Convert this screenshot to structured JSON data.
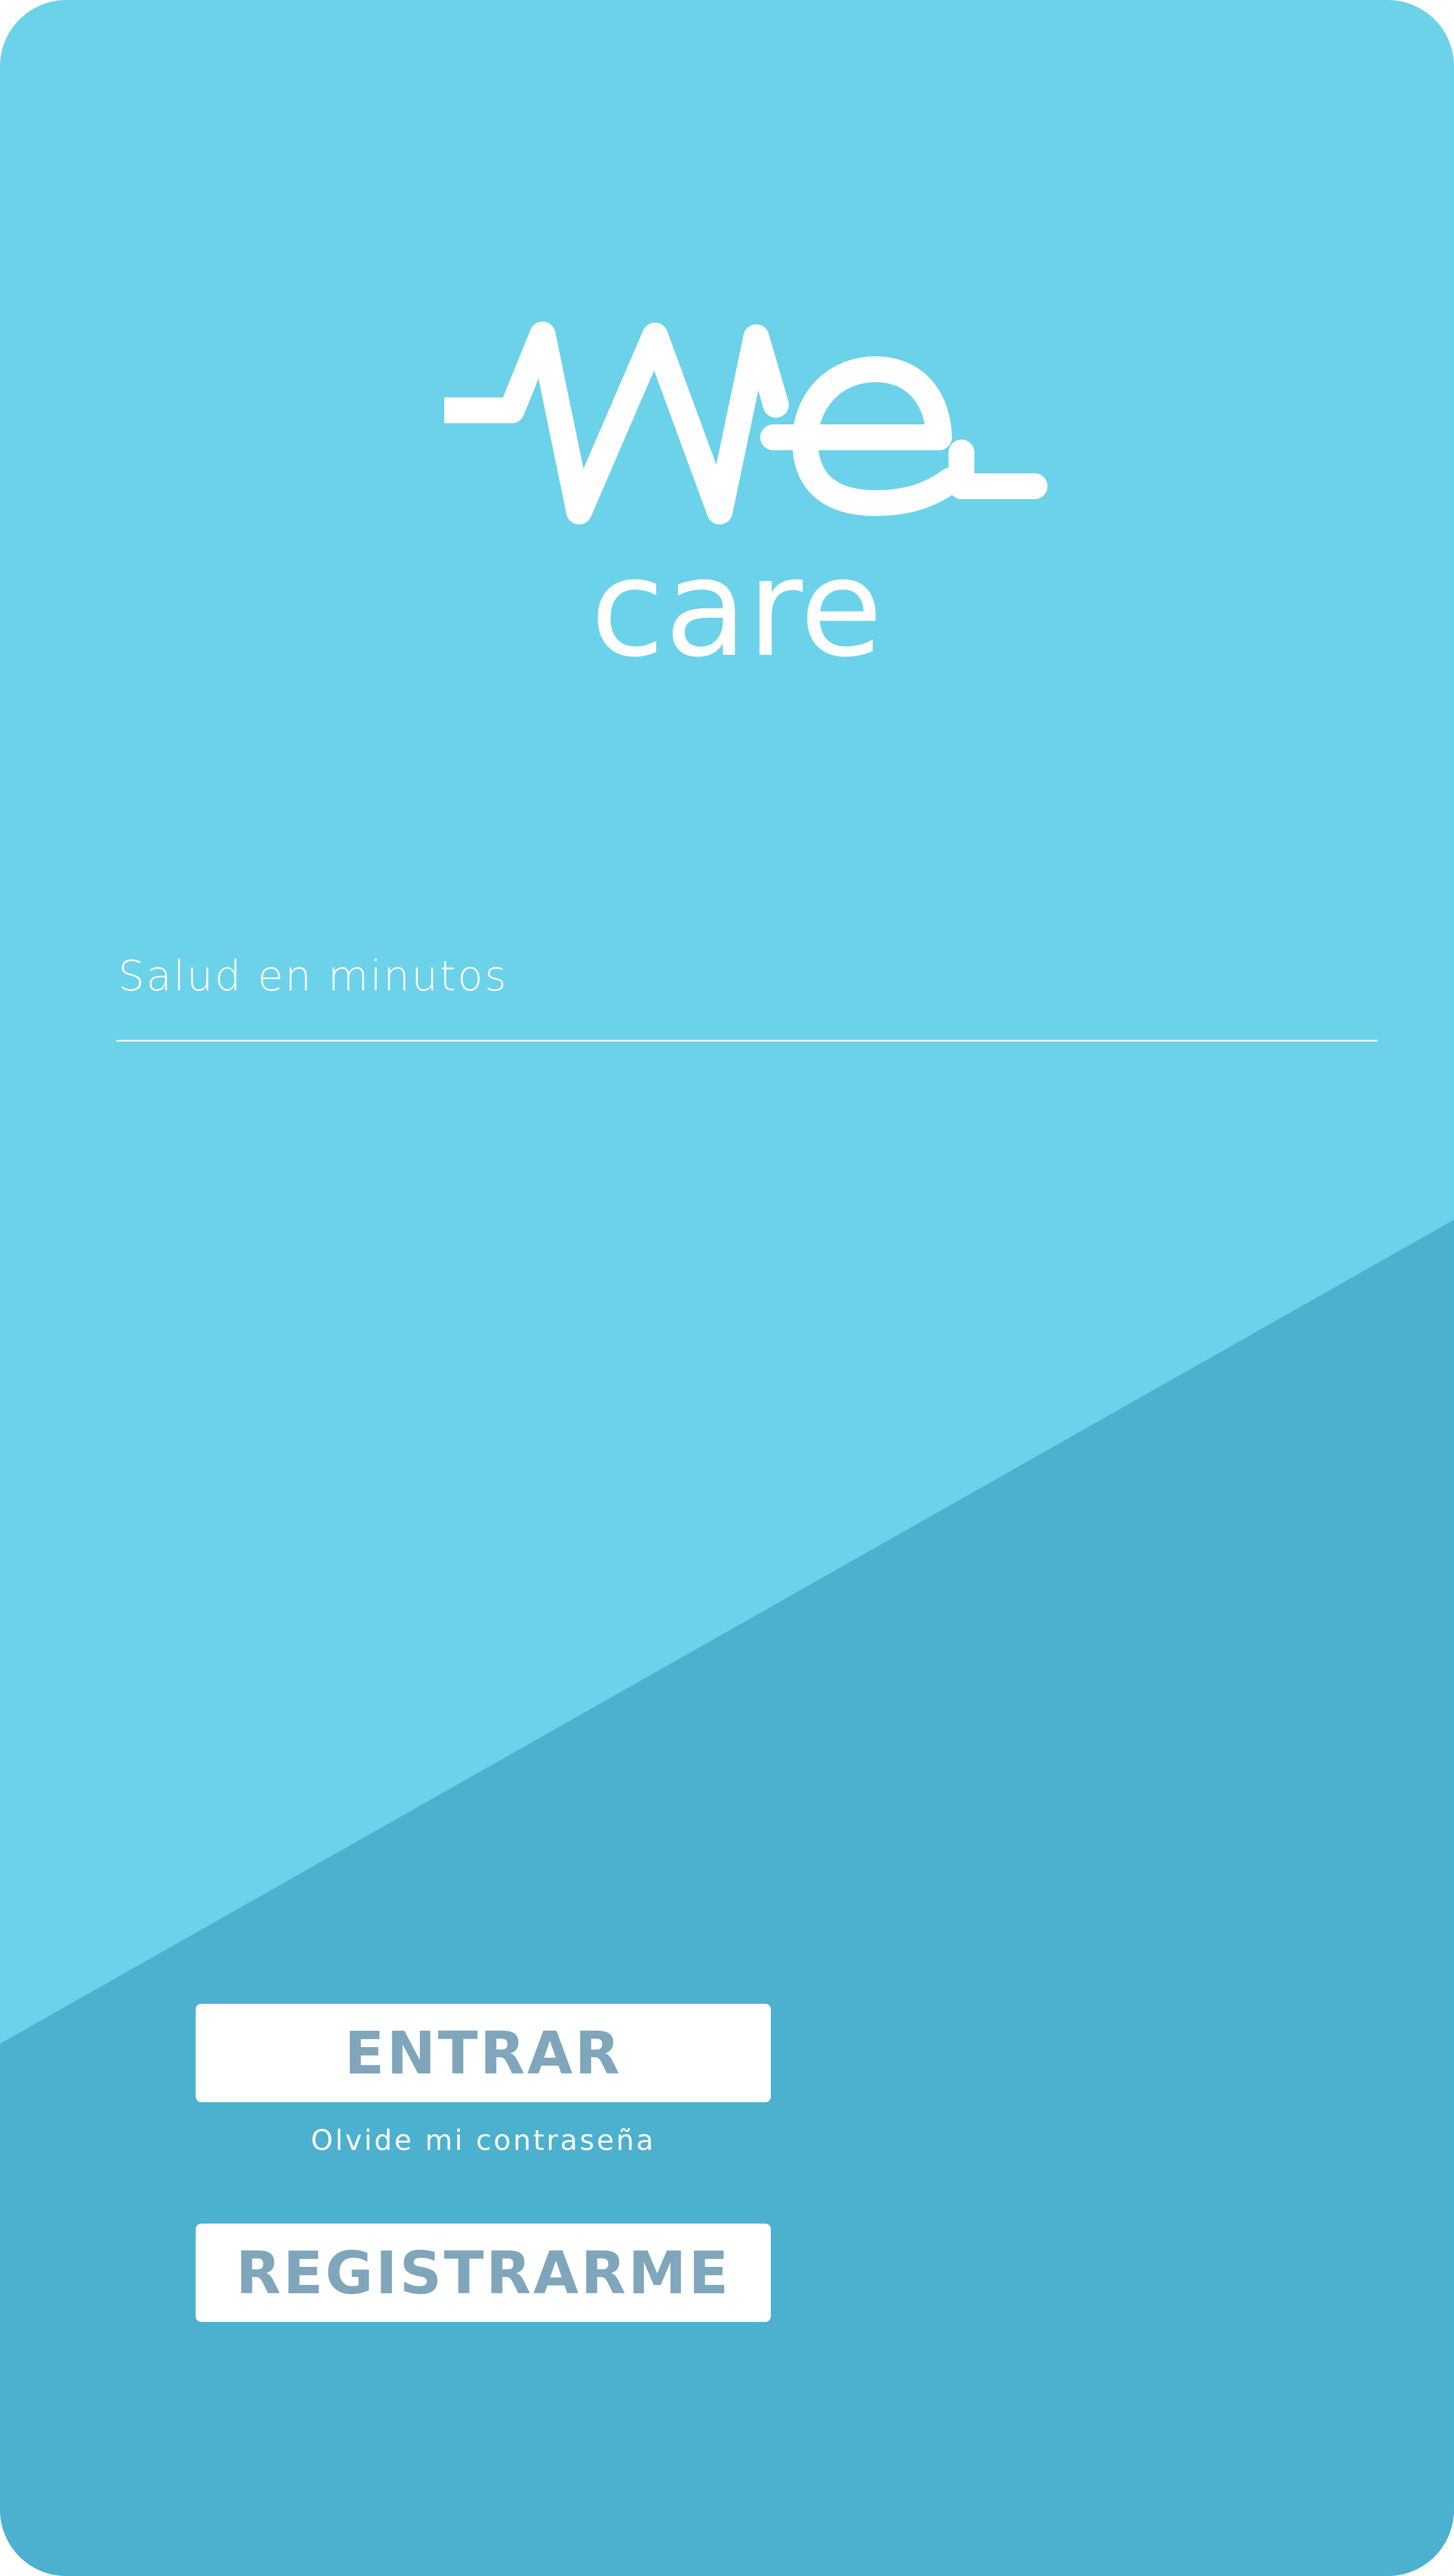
{
  "colors": {
    "background_light": "#6bd2ea",
    "background_dark": "#4cb0cf",
    "button_background": "#ffffff",
    "button_text": "#7fa6ba",
    "text": "#ffffff"
  },
  "logo": {
    "wordmark_top": "We",
    "wordmark_bottom": "care"
  },
  "login": {
    "tagline": "Salud en minutos",
    "enter_label": "ENTRAR",
    "forgot_label": "Olvide mi contraseña",
    "register_label": "REGISTRARME"
  }
}
